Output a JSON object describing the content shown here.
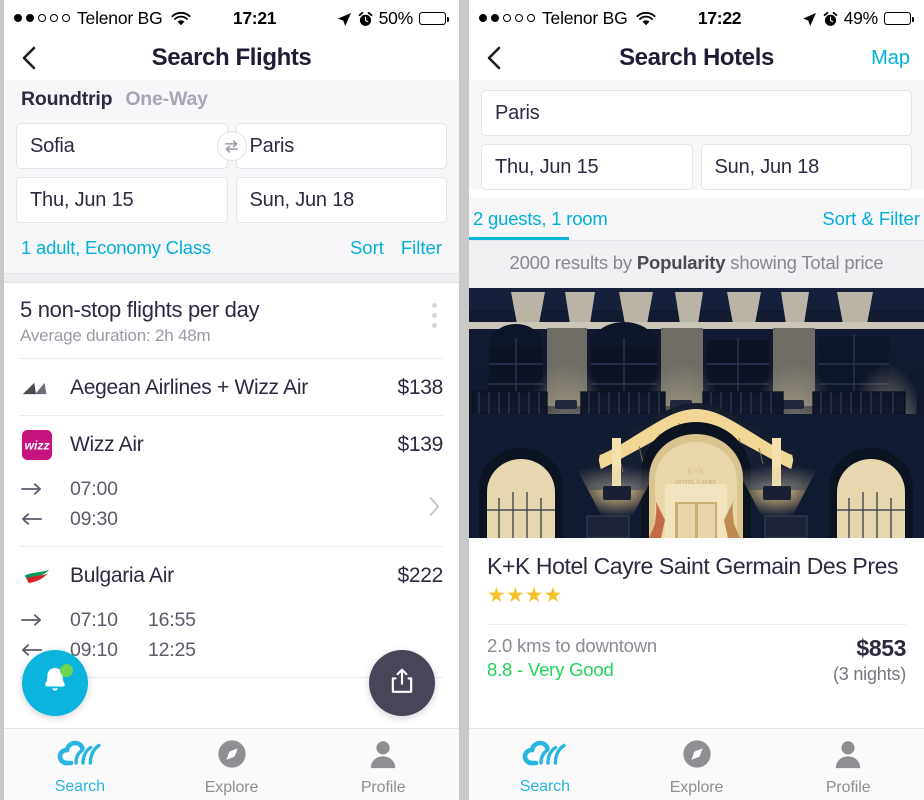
{
  "left": {
    "statusbar": {
      "carrier": "Telenor BG",
      "time": "17:21",
      "battery_pct": "50%",
      "battery_level": 50,
      "signal_filled": 2,
      "signal_total": 5,
      "wifi_icon": "wifi-icon",
      "location_icon": "location-arrow-icon",
      "alarm_icon": "alarm-clock-icon"
    },
    "nav": {
      "back_icon": "back-chevron-icon",
      "title": "Search Flights"
    },
    "trip_tabs": [
      {
        "label": "Roundtrip",
        "active": true
      },
      {
        "label": "One-Way",
        "active": false
      }
    ],
    "fields": {
      "origin": "Sofia",
      "destination": "Paris",
      "depart_date": "Thu, Jun 15",
      "return_date": "Sun, Jun 18",
      "swap_icon": "swap-arrows-icon"
    },
    "meta": {
      "passengers": "1 adult, Economy Class",
      "sort": "Sort",
      "filter": "Filter"
    },
    "results_header": {
      "title": "5 non-stop flights per day",
      "subtitle": "Average duration: 2h 48m",
      "menu_icon": "kebab-menu-icon"
    },
    "flights": [
      {
        "airline": "Aegean Airlines + Wizz Air",
        "price": "$138",
        "logo": "aegean-airlines-logo",
        "times": []
      },
      {
        "airline": "Wizz Air",
        "price": "$139",
        "logo": "wizz-air-logo",
        "times": [
          {
            "dir": "depart-arrow-icon",
            "t1": "07:00",
            "t2": ""
          },
          {
            "dir": "return-arrow-icon",
            "t1": "09:30",
            "t2": ""
          }
        ]
      },
      {
        "airline": "Bulgaria Air",
        "price": "$222",
        "logo": "bulgaria-air-logo",
        "times": [
          {
            "dir": "depart-arrow-icon",
            "t1": "07:10",
            "t2": "16:55"
          },
          {
            "dir": "return-arrow-icon",
            "t1": "09:10",
            "t2": "12:25"
          }
        ]
      }
    ],
    "fabs": {
      "alert_icon": "bell-icon",
      "alert_badge": true,
      "share_icon": "share-upload-icon"
    },
    "tabbar": [
      {
        "label": "Search",
        "icon": "skyscanner-cloud-icon",
        "active": true
      },
      {
        "label": "Explore",
        "icon": "compass-icon",
        "active": false
      },
      {
        "label": "Profile",
        "icon": "person-icon",
        "active": false
      }
    ]
  },
  "right": {
    "statusbar": {
      "carrier": "Telenor BG",
      "time": "17:22",
      "battery_pct": "49%",
      "battery_level": 49,
      "signal_filled": 2,
      "signal_total": 5,
      "wifi_icon": "wifi-icon",
      "location_icon": "location-arrow-icon",
      "alarm_icon": "alarm-clock-icon"
    },
    "nav": {
      "back_icon": "back-chevron-icon",
      "title": "Search Hotels",
      "action": "Map"
    },
    "fields": {
      "destination": "Paris",
      "checkin_date": "Thu, Jun 15",
      "checkout_date": "Sun, Jun 18"
    },
    "meta": {
      "guests": "2 guests, 1 room",
      "sort_filter": "Sort & Filter"
    },
    "results_bar": {
      "prefix": "2000 results by ",
      "emphasis": "Popularity",
      "suffix": " showing Total price"
    },
    "hotel": {
      "photo_alt": "hotel-facade-night-photo",
      "name": "K+K Hotel Cayre Saint Germain Des Pres",
      "stars": "★★★★",
      "star_count": 4,
      "distance": "2.0 kms to downtown",
      "rating": "8.8 - Very Good",
      "price": "$853",
      "nights": "(3 nights)"
    },
    "tabbar": [
      {
        "label": "Search",
        "icon": "skyscanner-cloud-icon",
        "active": true
      },
      {
        "label": "Explore",
        "icon": "compass-icon",
        "active": false
      },
      {
        "label": "Profile",
        "icon": "person-icon",
        "active": false
      }
    ]
  },
  "colors": {
    "accent": "#00b0d8",
    "accent_bright": "#0ab4dc",
    "text_dark": "#2d2a40",
    "text_muted": "#8b8a94",
    "rating_green": "#22d45a",
    "star_gold": "#f5c22b",
    "wizz_magenta": "#c6157f",
    "share_fab": "#4a4458",
    "badge_green": "#6fd44f"
  }
}
